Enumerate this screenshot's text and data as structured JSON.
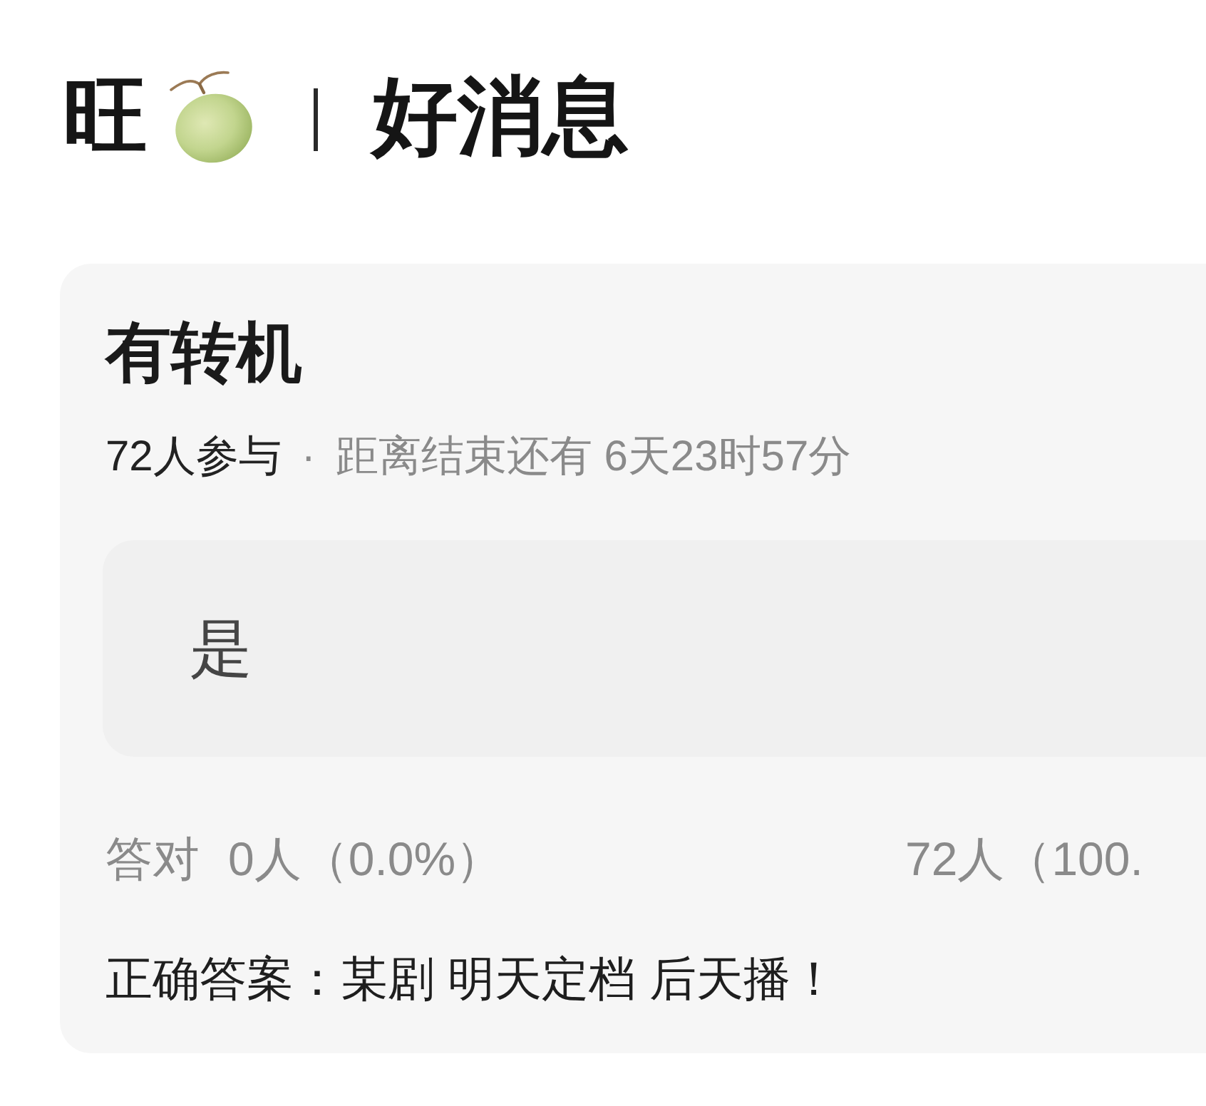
{
  "header": {
    "prefix": "旺",
    "headline": "好消息"
  },
  "poll": {
    "title": "有转机",
    "participants": "72人参与",
    "separator": "·",
    "countdown": "距离结束还有 6天23时57分",
    "options": [
      {
        "label": "是"
      }
    ],
    "stats": {
      "label": "答对",
      "correct": "0人（0.0%）",
      "option_votes": "72人（100."
    },
    "answer": "正确答案：某剧 明天定档 后天播！"
  }
}
